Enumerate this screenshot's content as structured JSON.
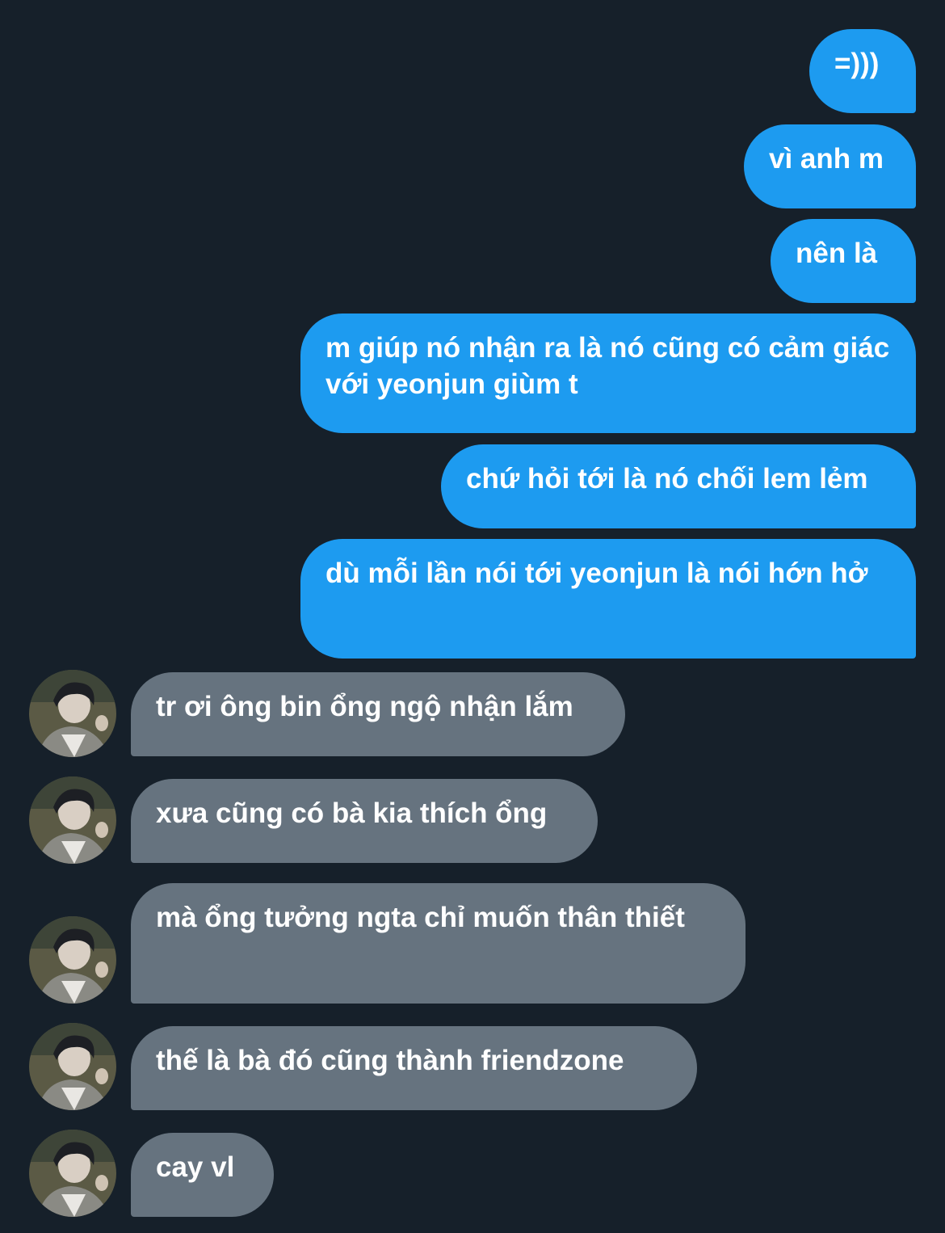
{
  "conversation": {
    "sent": [
      {
        "text": "=)))"
      },
      {
        "text": "vì anh m"
      },
      {
        "text": "nên là"
      },
      {
        "text": "m giúp nó nhận ra là nó cũng có cảm giác với yeonjun giùm t"
      },
      {
        "text": "chứ hỏi tới là nó chối lem lẻm"
      },
      {
        "text": "dù mỗi lần nói tới yeonjun là nói hớn hở"
      }
    ],
    "received": [
      {
        "text": "tr ơi ông bin ổng ngộ nhận lắm"
      },
      {
        "text": "xưa cũng có bà kia thích ổng"
      },
      {
        "text": "mà ổng tưởng ngta chỉ muốn thân thiết"
      },
      {
        "text": "thế là bà đó cũng thành friendzone"
      },
      {
        "text": "cay vl"
      }
    ]
  },
  "colors": {
    "background": "#16202a",
    "sent_bubble": "#1d9bf0",
    "received_bubble": "#66737f",
    "text": "#ffffff"
  },
  "icons": {
    "avatar": "profile-photo-avatar"
  }
}
